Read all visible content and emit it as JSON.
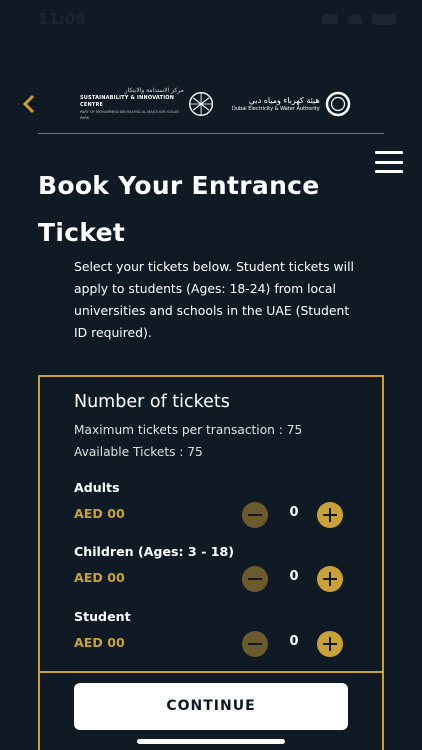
{
  "status_bar": {
    "time": "11:08"
  },
  "header": {
    "sic_logo": {
      "arabic": "مركز الاستدامة والابتكار",
      "english": "SUSTAINABILITY & INNOVATION CENTRE",
      "subtitle": "PART OF MOHAMMED BIN RASHID AL MAKTOUM SOLAR PARK"
    },
    "dewa_logo": {
      "arabic": "هيئة كهرباء ومياه دبي",
      "english": "Dubai Electricity & Water Authority"
    }
  },
  "page": {
    "title_line1": "Book Your Entrance",
    "title_line2": "Ticket",
    "intro": "Select your tickets below. Student tickets will apply to students (Ages: 18-24) from local universities and schools in the UAE (Student ID required)."
  },
  "ticket_card": {
    "title": "Number of tickets",
    "max_per_transaction": "Maximum tickets per transaction : 75",
    "available": "Available Tickets : 75",
    "rows": [
      {
        "label": "Adults",
        "price": "AED 00",
        "quantity": "0"
      },
      {
        "label": "Children (Ages: 3 - 18)",
        "price": "AED 00",
        "quantity": "0"
      },
      {
        "label": "Student",
        "price": "AED 00",
        "quantity": "0"
      }
    ]
  },
  "continue_label": "CONTINUE",
  "colors": {
    "accent": "#c9a13a",
    "background": "#0f1a24",
    "button_bg": "#ffffff"
  },
  "icons": {
    "back": "chevron-left-icon",
    "menu": "hamburger-menu-icon",
    "minus": "minus-circle-icon",
    "plus": "plus-circle-icon"
  }
}
